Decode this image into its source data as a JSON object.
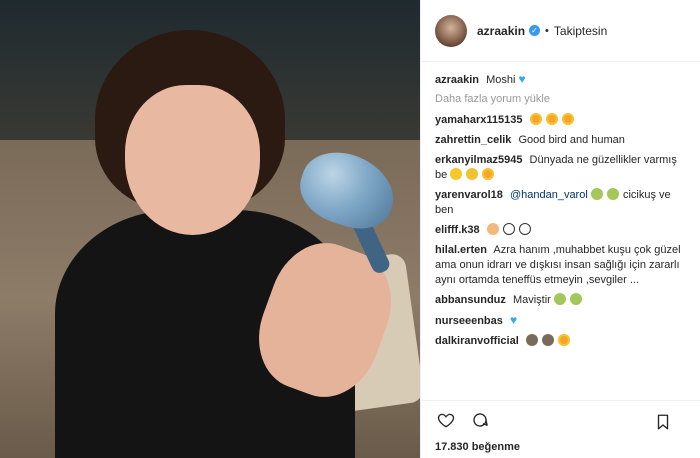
{
  "header": {
    "username": "azraakin",
    "follow_status": "Takiptesin"
  },
  "caption": {
    "user": "azraakin",
    "text": "Moshi",
    "emoji": "blue-heart-icon"
  },
  "load_more": "Daha fazla yorum yükle",
  "comments": [
    {
      "user": "yamaharx115135",
      "text": ""
    },
    {
      "user": "zahrettin_celik",
      "text": "Good bird and human"
    },
    {
      "user": "erkanyilmaz5945",
      "text": "Dünyada ne güzellikler varmış be"
    },
    {
      "user": "yarenvarol18",
      "mention": "@handan_varol",
      "text": "cicikuş ve ben"
    },
    {
      "user": "elifff.k38",
      "text": ""
    },
    {
      "user": "hilal.erten",
      "text": "Azra hanım ,muhabbet kuşu çok güzel ama onun idrarı ve dışkısı insan sağlığı için zararlı aynı ortamda teneffüs etmeyin ,sevgiler ..."
    },
    {
      "user": "abbansunduz",
      "text": "Maviştir"
    },
    {
      "user": "nurseeenbas",
      "text": ""
    },
    {
      "user": "dalkiranvofficial",
      "text": ""
    }
  ],
  "likes": "17.830 beğenme",
  "colors": {
    "link": "#003569",
    "verified": "#3897f0",
    "muted": "#999999"
  }
}
